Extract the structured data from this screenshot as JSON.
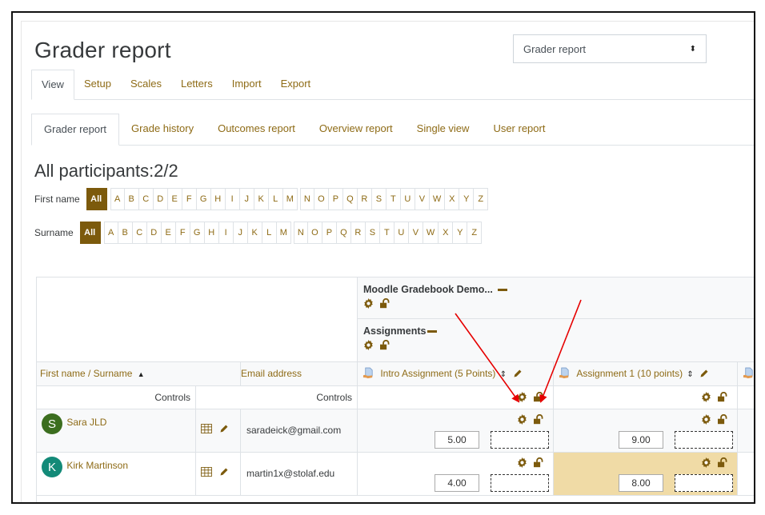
{
  "page": {
    "title": "Grader report",
    "jump_select": {
      "value": "Grader report"
    }
  },
  "tabs_primary": [
    {
      "label": "View",
      "active": true
    },
    {
      "label": "Setup"
    },
    {
      "label": "Scales"
    },
    {
      "label": "Letters"
    },
    {
      "label": "Import"
    },
    {
      "label": "Export"
    }
  ],
  "tabs_secondary": [
    {
      "label": "Grader report",
      "active": true
    },
    {
      "label": "Grade history"
    },
    {
      "label": "Outcomes report"
    },
    {
      "label": "Overview report"
    },
    {
      "label": "Single view"
    },
    {
      "label": "User report"
    }
  ],
  "participants": {
    "heading": "All participants:2/2",
    "first_name_label": "First name",
    "surname_label": "Surname",
    "all_label": "All",
    "letters": [
      "A",
      "B",
      "C",
      "D",
      "E",
      "F",
      "G",
      "H",
      "I",
      "J",
      "K",
      "L",
      "M",
      "N",
      "O",
      "P",
      "Q",
      "R",
      "S",
      "T",
      "U",
      "V",
      "W",
      "X",
      "Y",
      "Z"
    ]
  },
  "table": {
    "course_category": "Moodle Gradebook Demo...",
    "sub_category": "Assignments",
    "col_name_header": "First name / Surname",
    "sort_indicator": "▲",
    "col_email_header": "Email address",
    "controls_label": "Controls",
    "items": [
      {
        "name": "Intro Assignment (5 Points)"
      },
      {
        "name": "Assignment 1 (10 points)"
      }
    ],
    "students": [
      {
        "initial": "S",
        "name": "Sara JLD",
        "email": "saradeick@gmail.com",
        "avatar_color": "#3c6e1f",
        "grades": [
          "5.00",
          "9.00"
        ],
        "highlight": [
          false,
          false
        ]
      },
      {
        "initial": "K",
        "name": "Kirk Martinson",
        "email": "martin1x@stolaf.edu",
        "avatar_color": "#138a78",
        "grades": [
          "4.00",
          "8.00"
        ],
        "highlight": [
          false,
          true
        ]
      }
    ]
  },
  "colors": {
    "accent": "#7c5a0c",
    "link": "#8e6b16",
    "highlight_cell": "#f0dba6",
    "annotation_arrow": "#e60000"
  }
}
